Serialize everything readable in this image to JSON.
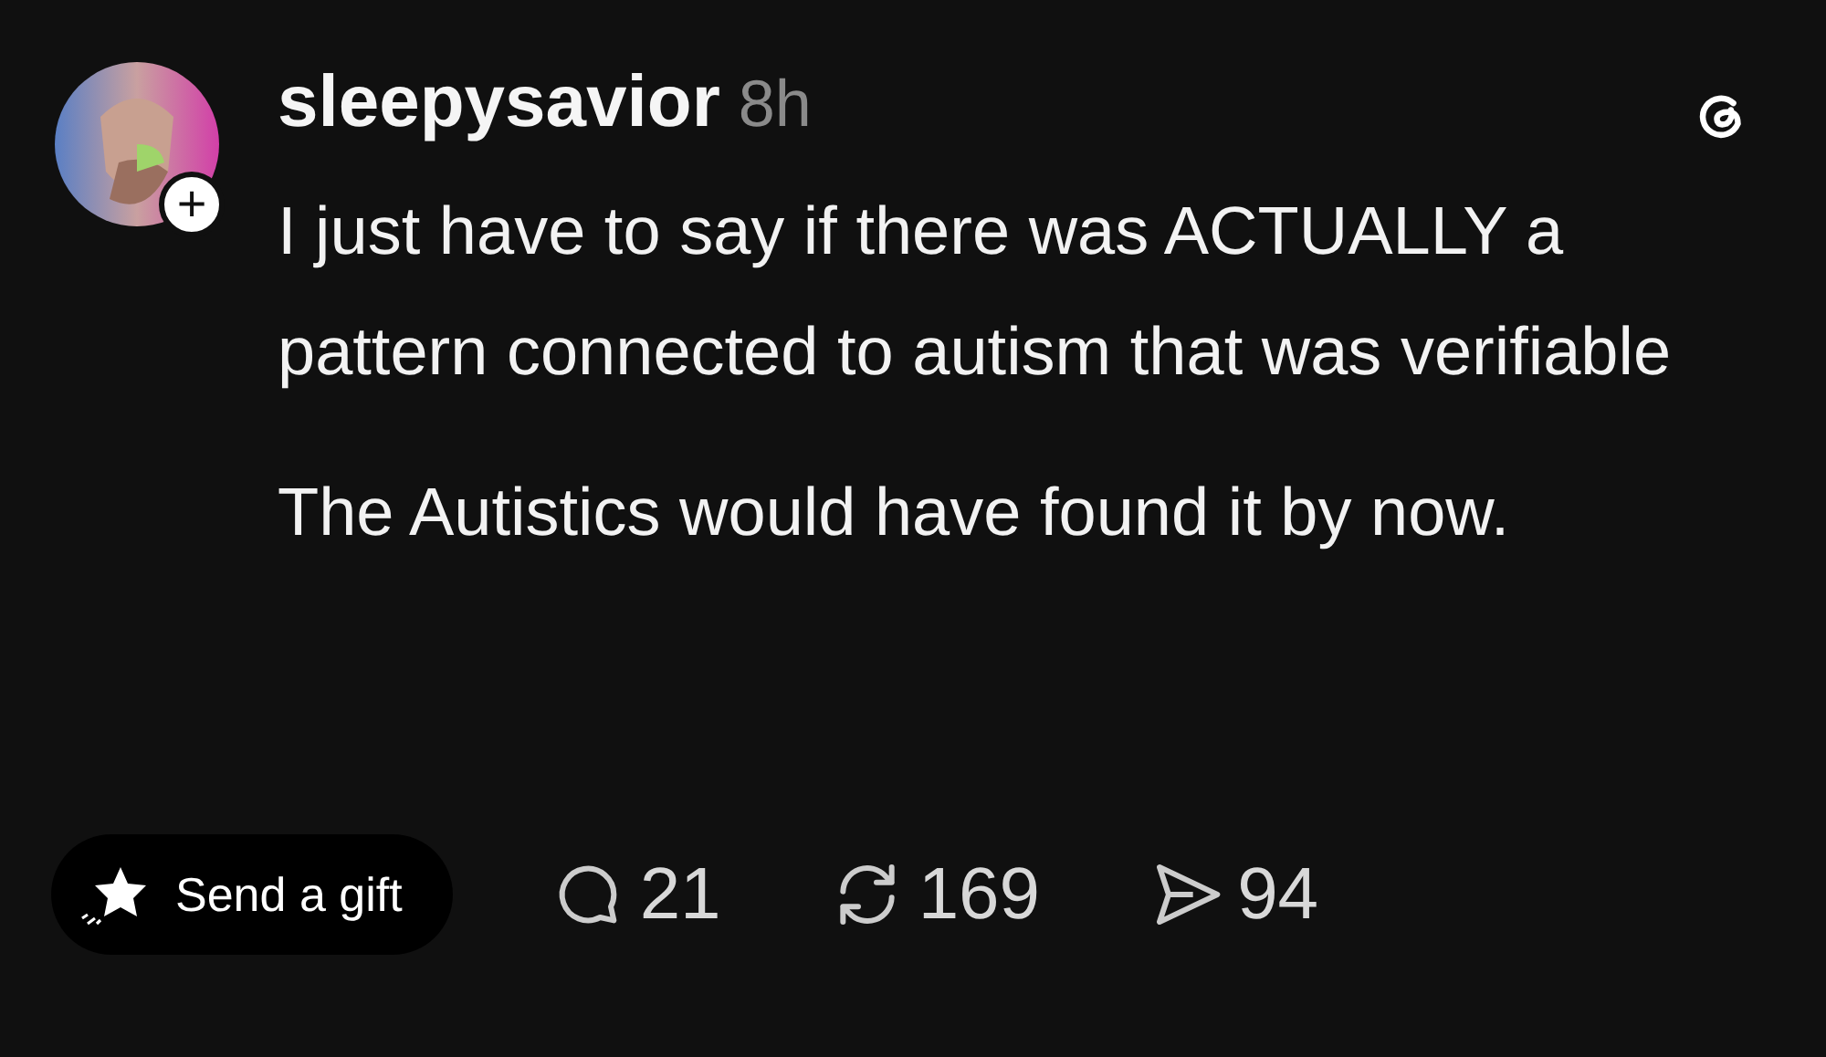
{
  "post": {
    "author": "sleepysavior",
    "time": "8h",
    "follow_badge": "+",
    "paragraphs": [
      "I just have to say if there was ACTUALLY a pattern connected to autism that was verifiable",
      "The Autistics would have found it by now."
    ]
  },
  "gift_button": {
    "label": "Send a gift"
  },
  "stats": [
    {
      "kind": "reply",
      "count": "21"
    },
    {
      "kind": "repost",
      "count": "169"
    },
    {
      "kind": "share",
      "count": "94"
    }
  ]
}
